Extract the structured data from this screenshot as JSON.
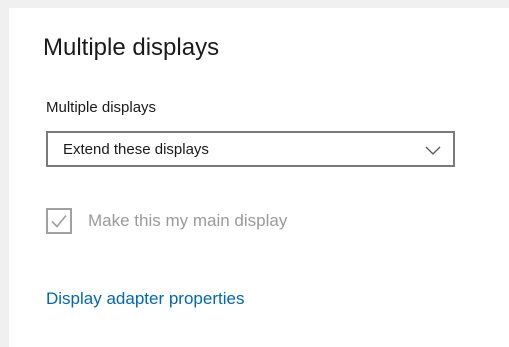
{
  "section": {
    "title": "Multiple displays"
  },
  "display_mode": {
    "label": "Multiple displays",
    "selected": "Extend these displays",
    "icon": "chevron-down-icon"
  },
  "main_display": {
    "label": "Make this my main display",
    "checked": true,
    "disabled": true,
    "icon": "checkmark-icon"
  },
  "links": {
    "adapter_properties": "Display adapter properties"
  },
  "colors": {
    "link": "#0067b8",
    "disabled_text": "#9a9a9a",
    "dropdown_border": "#7a7a7a",
    "background": "#ffffff"
  }
}
